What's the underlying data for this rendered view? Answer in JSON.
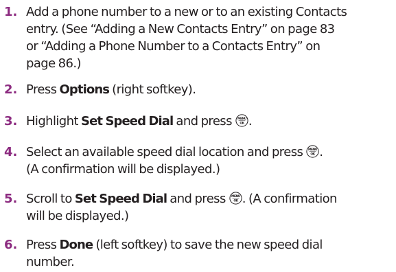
{
  "steps": [
    {
      "number": "1.",
      "lines": [
        "Add a phone number to a new or to an existing Contacts",
        "entry. (See “Adding a New Contacts Entry” on page 83",
        "or “Adding a Phone Number to a Contacts Entry” on",
        "page 86.)"
      ]
    },
    {
      "number": "2.",
      "pre": "Press ",
      "bold": "Options",
      "post": " (right softkey)."
    },
    {
      "number": "3.",
      "pre": "Highlight ",
      "bold": "Set Speed Dial",
      "post": " and press",
      "end": "."
    },
    {
      "number": "4.",
      "pre": "Select an available speed dial location and press",
      "end": ".",
      "line2": "(A confirmation will be displayed.)"
    },
    {
      "number": "5.",
      "pre": "Scroll to ",
      "bold": "Set Speed Dial",
      "post": " and press",
      "end": ". (A confirmation",
      "line2": "will be displayed.)"
    },
    {
      "number": "6.",
      "pre": "Press ",
      "bold": "Done",
      "post": " (left softkey) to save the new speed dial",
      "line2": "number."
    }
  ],
  "menu_key": {
    "icon": "menu-ok-key-icon",
    "top_text": "MENU",
    "bottom_text": "OK"
  }
}
